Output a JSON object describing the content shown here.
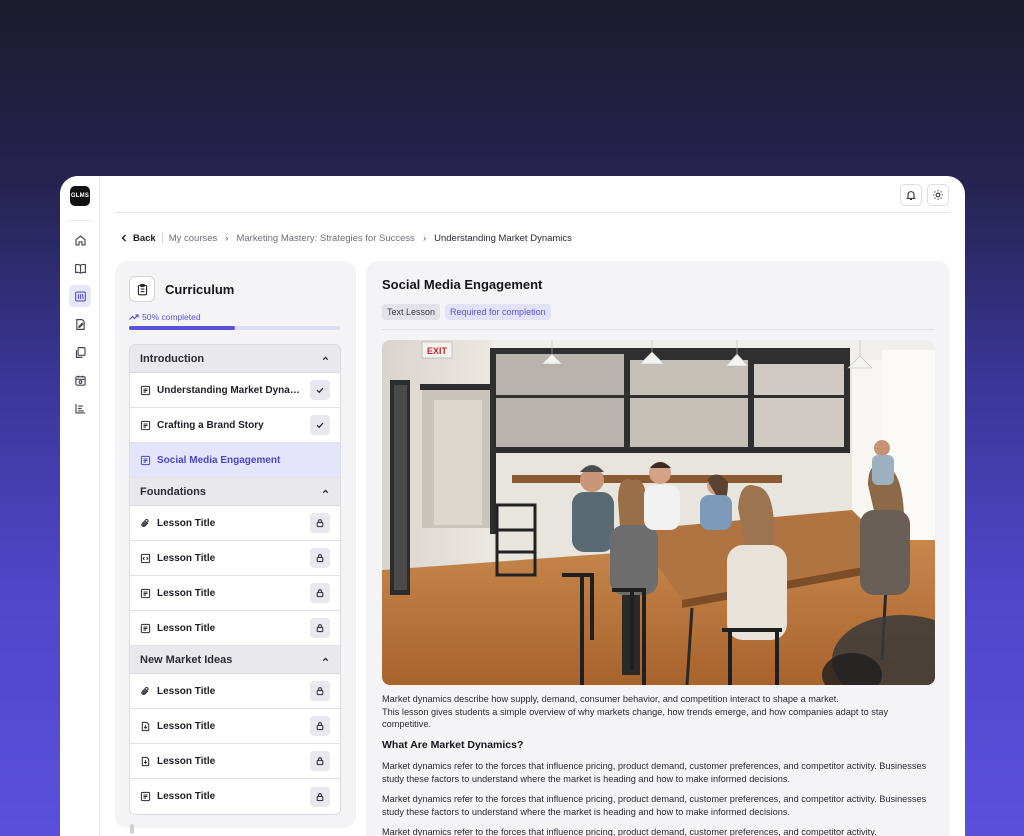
{
  "app": {
    "logo_text": "GLMS"
  },
  "rail": {
    "items": [
      {
        "icon": "home-icon"
      },
      {
        "icon": "book-icon"
      },
      {
        "icon": "library-icon",
        "active": true
      },
      {
        "icon": "document-edit-icon"
      },
      {
        "icon": "copy-icon"
      },
      {
        "icon": "calendar-icon"
      },
      {
        "icon": "report-icon"
      }
    ]
  },
  "topbar": {
    "notification_icon": "bell-icon",
    "theme_icon": "sun-icon"
  },
  "breadcrumb": {
    "back_label": "Back",
    "items": [
      "My courses",
      "Marketing Mastery: Strategies for Success",
      "Understanding Market Dynamics"
    ]
  },
  "curriculum": {
    "title": "Curriculum",
    "progress_label": "50% completed",
    "progress": 0.5,
    "sections": [
      {
        "title": "Introduction",
        "lessons": [
          {
            "title": "Understanding Market Dynamics",
            "icon": "text-lesson-icon",
            "status": "completed"
          },
          {
            "title": "Crafting a Brand Story",
            "icon": "text-lesson-icon",
            "status": "completed"
          },
          {
            "title": "Social Media Engagement",
            "icon": "text-lesson-icon",
            "status": "current"
          }
        ]
      },
      {
        "title": "Foundations",
        "lessons": [
          {
            "title": "Lesson Title",
            "icon": "attachment-icon",
            "status": "locked"
          },
          {
            "title": "Lesson Title",
            "icon": "code-icon",
            "status": "locked"
          },
          {
            "title": "Lesson Title",
            "icon": "text-lesson-icon",
            "status": "locked"
          },
          {
            "title": "Lesson Title",
            "icon": "text-lesson-icon",
            "status": "locked"
          }
        ]
      },
      {
        "title": "New Market Ideas",
        "lessons": [
          {
            "title": "Lesson Title",
            "icon": "attachment-icon",
            "status": "locked"
          },
          {
            "title": "Lesson Title",
            "icon": "download-file-icon",
            "status": "locked"
          },
          {
            "title": "Lesson Title",
            "icon": "download-file-icon",
            "status": "locked"
          },
          {
            "title": "Lesson Title",
            "icon": "text-lesson-icon",
            "status": "locked"
          }
        ]
      }
    ]
  },
  "lesson": {
    "title": "Social Media Engagement",
    "tags": [
      "Text Lesson",
      "Required for completion"
    ],
    "image_alt": "team meeting photo",
    "intro": [
      "Market dynamics describe how supply, demand, consumer behavior, and competition interact to shape a market.",
      "This lesson gives students a simple overview of why markets change, how trends emerge, and how companies adapt to stay competitive."
    ],
    "heading": "What Are Market Dynamics?",
    "paragraphs": [
      "Market dynamics refer to the forces that influence pricing, product demand, customer preferences, and competitor activity. Businesses study these factors to understand where the market is heading and how to make informed decisions.",
      "Market dynamics refer to the forces that influence pricing, product demand, customer preferences, and competitor activity. Businesses study these factors to understand where the market is heading and how to make informed decisions.",
      "Market dynamics refer to the forces that influence pricing, product demand, customer preferences, and competitor activity."
    ]
  },
  "colors": {
    "accent": "#5a52d6",
    "active_row_bg": "#e4e5fb"
  }
}
